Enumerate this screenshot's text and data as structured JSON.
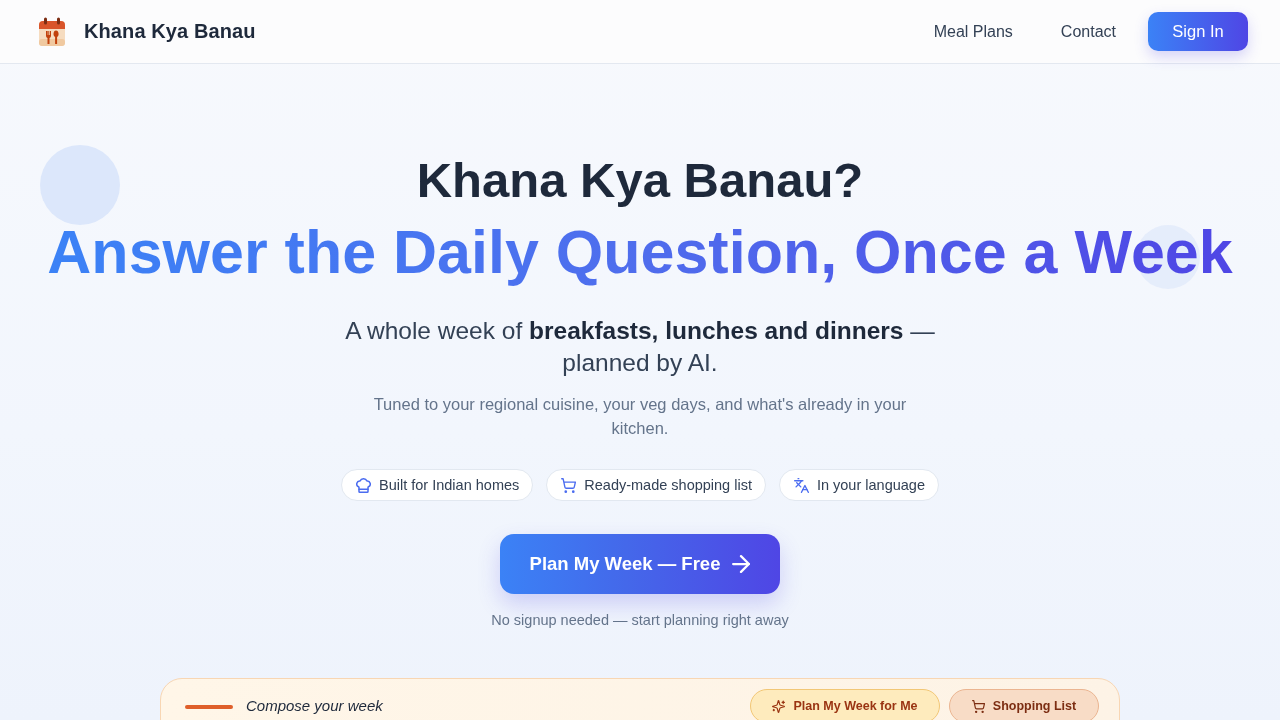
{
  "header": {
    "brand": "Khana Kya Banau",
    "nav": [
      {
        "label": "Meal Plans"
      },
      {
        "label": "Contact"
      }
    ],
    "sign_in": "Sign In"
  },
  "hero": {
    "title": "Khana Kya Banau?",
    "headline": "Answer the Daily Question, Once a Week",
    "subtitle": "A whole week of **breakfasts, lunches and dinners** — planned by AI.",
    "description": "Tuned to your regional cuisine, your veg days, and what's already in your kitchen.",
    "features": [
      {
        "kind": "home",
        "label": "Built for Indian homes"
      },
      {
        "kind": "shopping",
        "label": "Ready-made shopping list"
      },
      {
        "kind": "language",
        "label": "In your language"
      }
    ],
    "cta": "Plan My Week — Free",
    "note": "No signup needed — start planning right away"
  },
  "composer": {
    "title": "Compose your week",
    "actions": [
      {
        "kind": "plan",
        "label": "Plan My Week for Me"
      },
      {
        "kind": "shopping",
        "label": "Shopping List"
      }
    ]
  }
}
